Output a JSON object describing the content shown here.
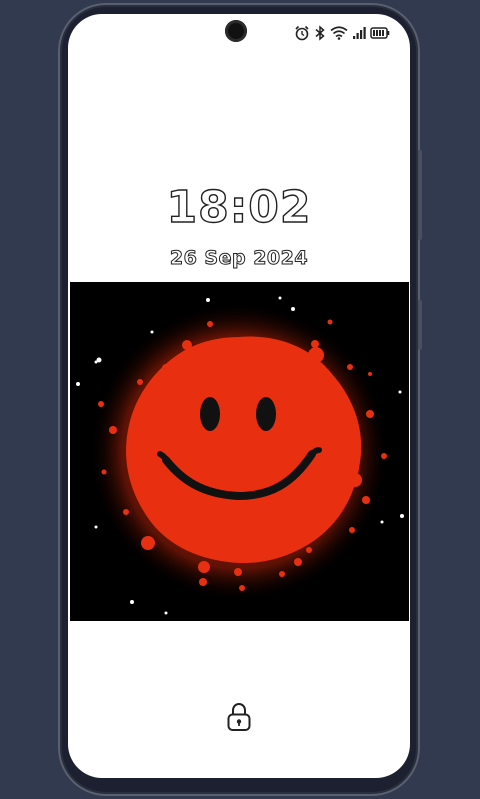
{
  "lockscreen": {
    "time": "18:02",
    "date": "26 Sep 2024"
  },
  "status_bar": {
    "icons": [
      "alarm-icon",
      "bluetooth-icon",
      "wifi-icon",
      "signal-icon",
      "battery-icon"
    ]
  },
  "wallpaper": {
    "subject": "smiley-face-icon",
    "colors": {
      "background": "#000000",
      "face": "#e83010",
      "features": "#111111"
    }
  },
  "lock_icon": "lock-icon"
}
